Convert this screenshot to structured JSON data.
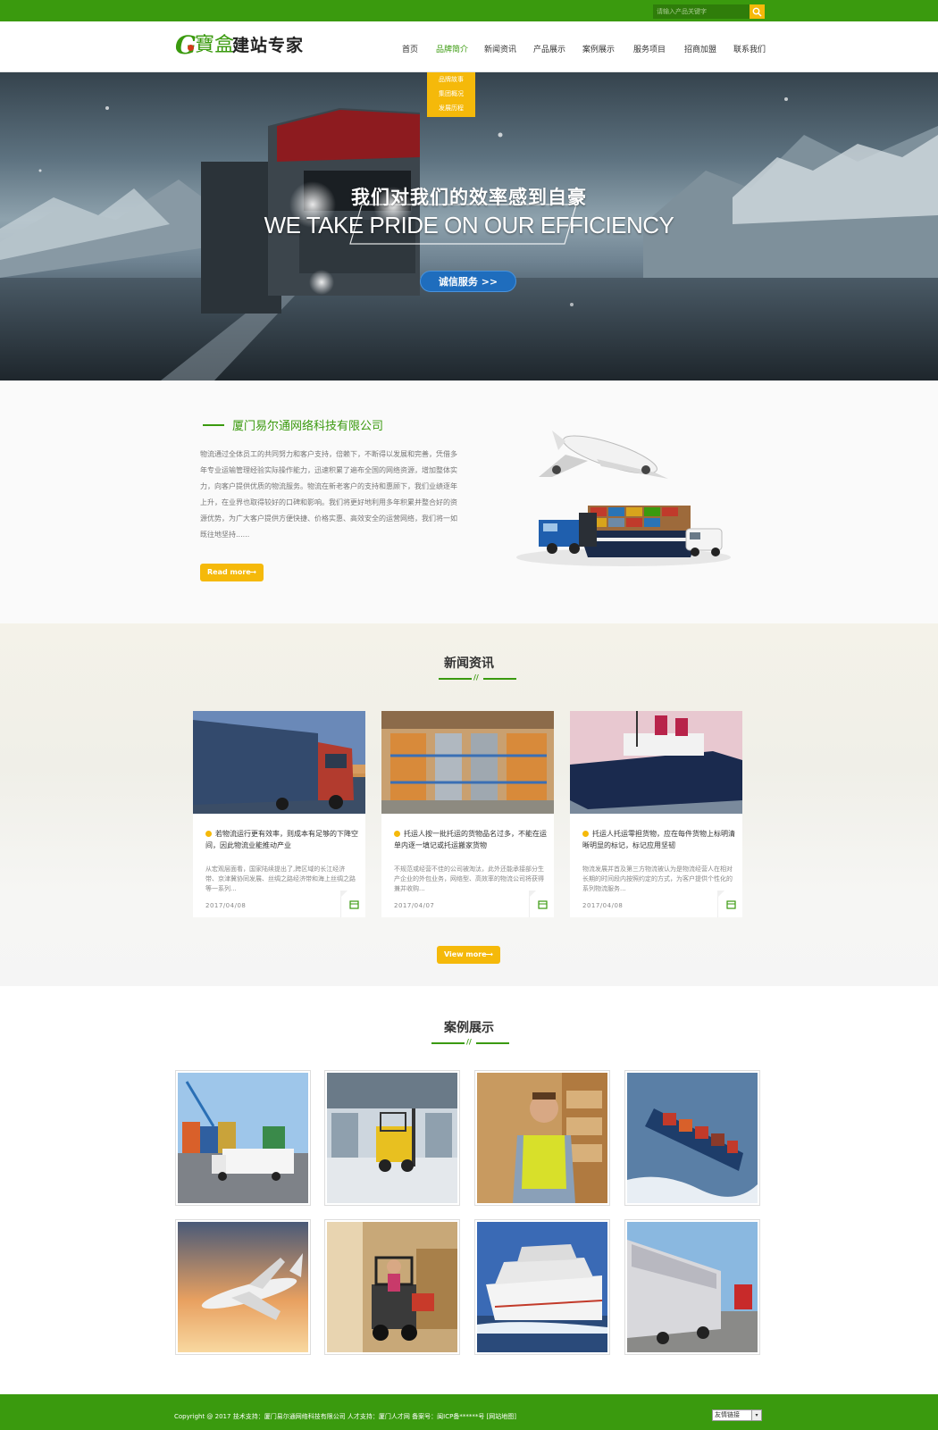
{
  "search": {
    "placeholder": "请输入产品关键字"
  },
  "logo": {
    "g": "G",
    "bao": "寶盒",
    "text": "建站专家"
  },
  "nav": {
    "items": [
      {
        "label": "首页"
      },
      {
        "label": "品牌简介"
      },
      {
        "label": "新闻资讯"
      },
      {
        "label": "产品展示"
      },
      {
        "label": "案例展示"
      },
      {
        "label": "服务项目"
      },
      {
        "label": "招商加盟"
      },
      {
        "label": "联系我们"
      }
    ],
    "active_index": 1,
    "dropdown": [
      "品牌故事",
      "集团概况",
      "发展历程"
    ]
  },
  "banner": {
    "title_cn": "我们对我们的效率感到自豪",
    "title_en": "WE TAKE PRIDE ON OUR EFFICIENCY",
    "button": "诚信服务 >>"
  },
  "about": {
    "title": "厦门易尔通网络科技有限公司",
    "text": "物流通过全体员工的共同努力和客户支持，倍赖下，不断得以发展和完善，凭借多年专业运输管理经验实际操作能力，迅速积累了遍布全国的网络资源，增加整体实力，向客户提供优质的物流服务。物流在新老客户的支持和惠顾下，我们业绩逐年上升，在业界也取得较好的口碑和影响。我们将更好地利用多年积累并整合好的资源优势，为广大客户提供方便快捷、价格实惠、高效安全的运营网络，我们将一如既往地坚持......",
    "read_more": "Read more"
  },
  "news": {
    "title": "新闻资讯",
    "mark": "//",
    "view_more": "View more",
    "items": [
      {
        "title": "若物流运行更有效率，则成本有足够的下降空间，因此物流业能推动产业",
        "desc": "从宏观层面看，国家陆续提出了,跨区域的长江经济带、京津冀协同发展、丝绸之路经济带和海上丝绸之路等一系列...",
        "date": "2017/04/08"
      },
      {
        "title": "托运人按一批托运的货物品名过多，不能在运单内逐一填记或托运搬家货物",
        "desc": "不规范或经营不佳的公司被淘汰，此外还能承接部分生产企业的外包业务，网络型、高效率的物流公司将获得兼并收购...",
        "date": "2017/04/07"
      },
      {
        "title": "托运人托运零担货物，应在每件货物上标明清晰明显的标记，标记应用坚韧",
        "desc": "物流发展并首及第三方物流被认为是物流经营人在相对长期的时间段内按照约定的方式，为客户提供个性化的系列物流服务...",
        "date": "2017/04/08"
      }
    ]
  },
  "cases": {
    "title": "案例展示",
    "mark": "//"
  },
  "footer": {
    "text": "Copyright @ 2017 技术支持：厦门易尔通网络科技有限公司 人才支持：厦门人才网  备案号：闽ICP备******号 [网站地图]",
    "select": "友情链接",
    "select_arrow": "▾"
  },
  "colors": {
    "brand_green": "#3a9a0e",
    "accent_yellow": "#f5b90a",
    "banner_button_blue": "#1f6dbd"
  }
}
